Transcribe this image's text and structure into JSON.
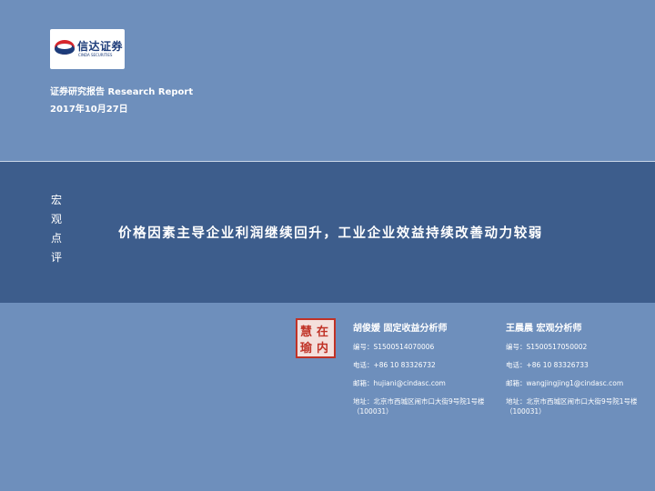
{
  "logo": {
    "name_cn": "信达证券",
    "name_en": "CINDA SECURITIES",
    "colors": {
      "red": "#d7262b",
      "navy": "#1d3c7a"
    }
  },
  "header": {
    "report_type": "证券研究报告 Research Report",
    "date": "2017年10月27日"
  },
  "band": {
    "category_chars": [
      "宏",
      "观",
      "点",
      "评"
    ],
    "headline": "价格因素主导企业利润继续回升，工业企业效益持续改善动力较弱"
  },
  "seal": {
    "chars": [
      "在",
      "内",
      "慧",
      "瑜"
    ],
    "color": "#c03226"
  },
  "analysts": [
    {
      "name": "胡俊媛 固定收益分析师",
      "id": "编号：S1500514070006",
      "phone": "电话：+86 10 83326732",
      "email": "邮箱：hujiani@cindasc.com",
      "address": "地址：北京市西城区闹市口大街9号院1号楼（100031）"
    },
    {
      "name": "王晨晨 宏观分析师",
      "id": "编号：S1500517050002",
      "phone": "电话：+86 10 83326733",
      "email": "邮箱：wangjingjing1@cindasc.com",
      "address": "地址：北京市西城区闹市口大街9号院1号楼（100031）"
    }
  ],
  "colors": {
    "background": "#6e8fbc",
    "band": "#3d5d8c"
  }
}
